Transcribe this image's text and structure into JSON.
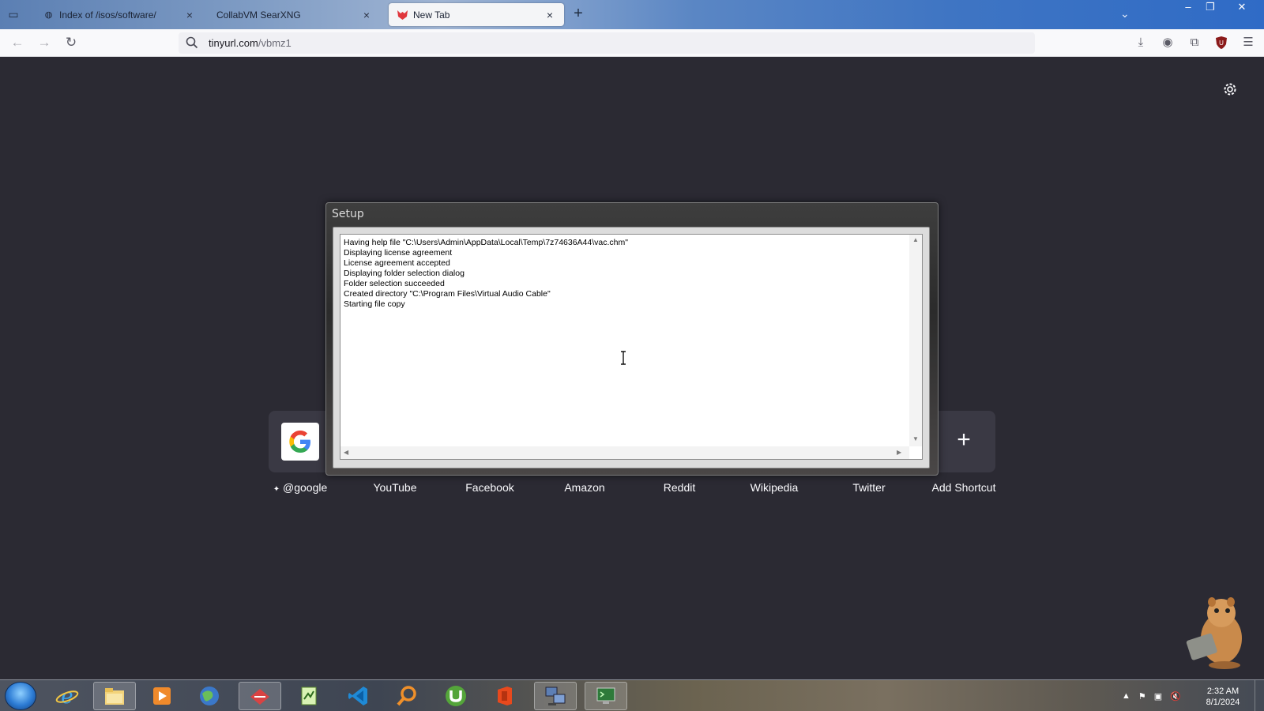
{
  "browser": {
    "tabs": [
      {
        "title": "Index of /isos/software/",
        "active": false
      },
      {
        "title": "CollabVM SearXNG",
        "active": false
      },
      {
        "title": "New Tab",
        "active": true
      }
    ],
    "url_host": "tinyurl.com",
    "url_path": "/vbmz1"
  },
  "shortcuts": [
    {
      "label": "@google",
      "pinned": true
    },
    {
      "label": "YouTube"
    },
    {
      "label": "Facebook"
    },
    {
      "label": "Amazon"
    },
    {
      "label": "Reddit"
    },
    {
      "label": "Wikipedia"
    },
    {
      "label": "Twitter"
    },
    {
      "label": "Add Shortcut"
    }
  ],
  "dialog": {
    "title": "Setup",
    "log": [
      "Having help file \"C:\\Users\\Admin\\AppData\\Local\\Temp\\7z74636A44\\vac.chm\"",
      "Displaying license agreement",
      "License agreement accepted",
      "Displaying folder selection dialog",
      "Folder selection succeeded",
      "Created directory \"C:\\Program Files\\Virtual Audio Cable\"",
      "Starting file copy"
    ]
  },
  "taskbar": {
    "time": "2:32 AM",
    "date": "8/1/2024",
    "apps": [
      "internet-explorer",
      "file-explorer",
      "media-player",
      "browser-globe",
      "lightshot",
      "notepad-plus",
      "vscode",
      "search-tool",
      "utorrent",
      "office",
      "network-app",
      "terminal-app"
    ]
  },
  "colors": {
    "page_bg": "#2b2a33",
    "shortcut_tile": "#3a3944",
    "text_light": "#fbfbfe"
  }
}
